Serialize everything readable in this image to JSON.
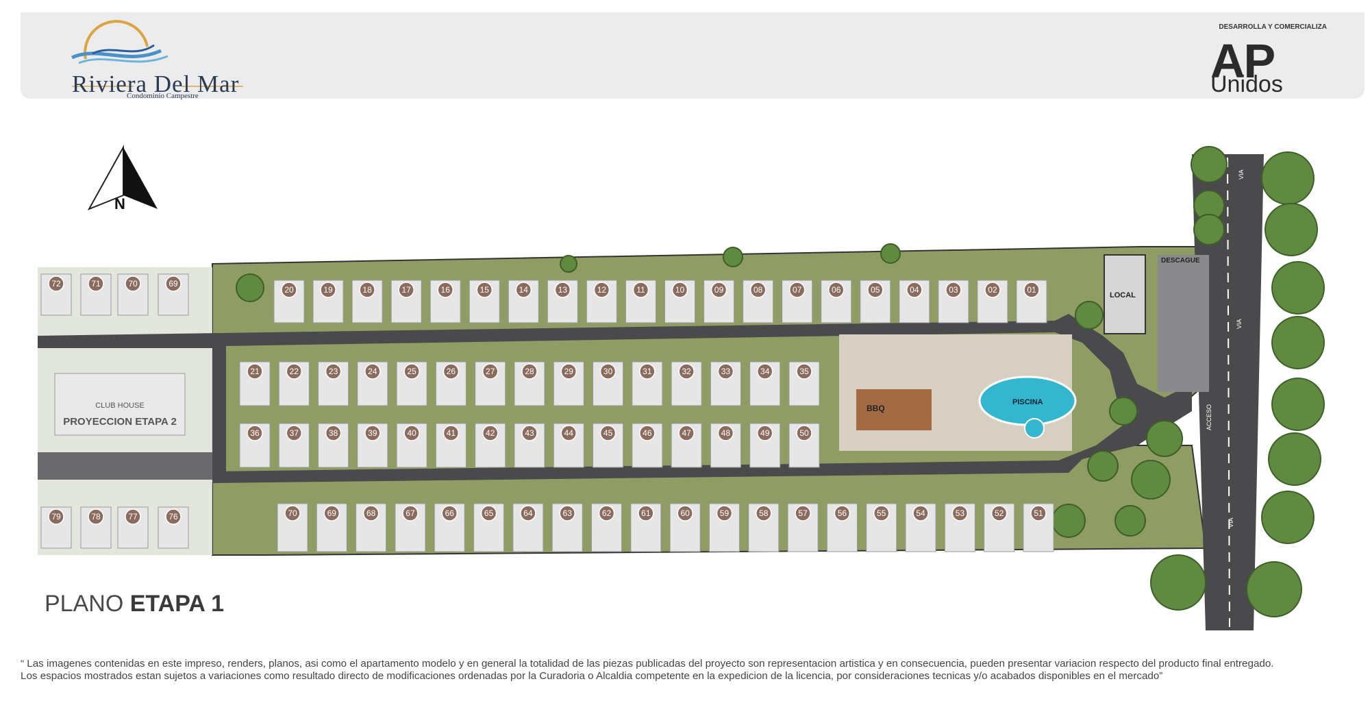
{
  "header": {
    "brand_name": "Riviera Del Mar",
    "brand_tagline": "Condominio Campestre",
    "developer_label": "DESARROLLA Y COMERCIALIZA",
    "developer_name_main": "AP",
    "developer_name_sub": "Unidos"
  },
  "compass": {
    "label": "N"
  },
  "map": {
    "etapa2": {
      "club_house_label": "CLUB HOUSE",
      "projection_label": "PROYECCION ETAPA 2",
      "lots": [
        "72",
        "71",
        "70",
        "69",
        "79",
        "78",
        "77",
        "76"
      ]
    },
    "lots_row_top": [
      "20",
      "19",
      "18",
      "17",
      "16",
      "15",
      "14",
      "13",
      "12",
      "11",
      "10",
      "09",
      "08",
      "07",
      "06",
      "05",
      "04",
      "03",
      "02",
      "01"
    ],
    "lots_row_mid1": [
      "21",
      "22",
      "23",
      "24",
      "25",
      "26",
      "27",
      "28",
      "29",
      "30",
      "31",
      "32",
      "33",
      "34",
      "35"
    ],
    "lots_row_mid2": [
      "36",
      "37",
      "38",
      "39",
      "40",
      "41",
      "42",
      "43",
      "44",
      "45",
      "46",
      "47",
      "48",
      "49",
      "50"
    ],
    "lots_row_bottom": [
      "70",
      "69",
      "68",
      "67",
      "66",
      "65",
      "64",
      "63",
      "62",
      "61",
      "60",
      "59",
      "58",
      "57",
      "56",
      "55",
      "54",
      "53",
      "52",
      "51"
    ],
    "amenities": {
      "bbq_label": "BBQ",
      "pool_label": "PISCINA",
      "local_label": "LOCAL",
      "drain_label": "DESCAGUE",
      "access_label": "ACCESO",
      "road_label_1": "VIA",
      "road_label_2": "VIA",
      "road_label_3": "VIA"
    }
  },
  "plan_title": {
    "prefix": "PLANO",
    "emphasis": "ETAPA 1"
  },
  "disclaimer": {
    "line1": "“ Las imagenes contenidas en este impreso, renders, planos, asi como el apartamento modelo y en general la totalidad de las piezas publicadas del proyecto son representacion artistica y en consecuencia, pueden presentar variacion respecto del producto final entregado.",
    "line2": "Los espacios mostrados estan sujetos a variaciones como resultado directo de modificaciones ordenadas por la Curadoria o Alcaldia competente en la expedicion de la licencia, por consideraciones tecnicas y/o acabados disponibles en el mercado”"
  },
  "colors": {
    "road": "#4a4a4d",
    "grass": "#8a9a5b",
    "lot_badge": "#8b6b5e",
    "pool": "#34b6cf",
    "brand_navy": "#2a3b56",
    "brand_gold": "#d9a441"
  }
}
